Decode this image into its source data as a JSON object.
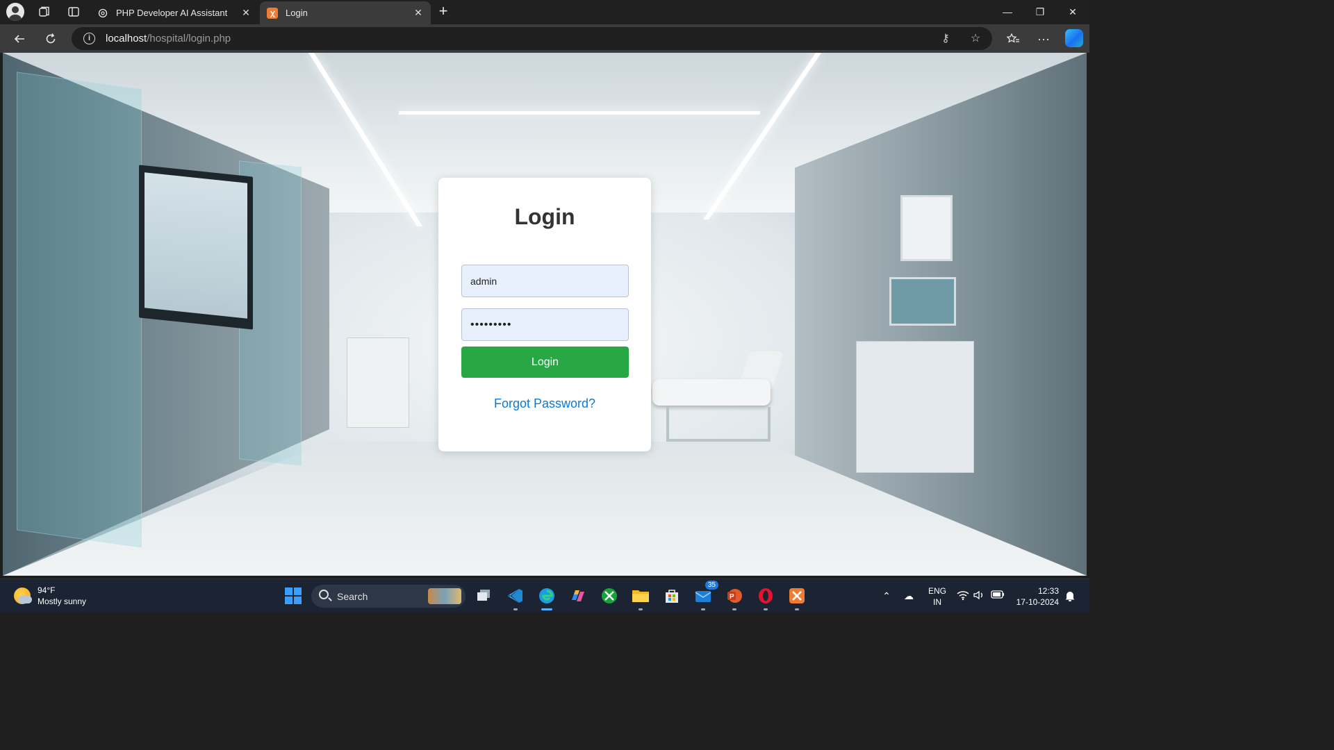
{
  "browser": {
    "tabs": [
      {
        "title": "PHP Developer AI Assistant",
        "icon": "openai-icon",
        "active": false
      },
      {
        "title": "Login",
        "icon": "xampp-icon",
        "active": true
      }
    ],
    "url_host": "localhost",
    "url_path": "/hospital/login.php"
  },
  "login": {
    "heading": "Login",
    "username_value": "admin",
    "password_value": "•••••••••",
    "button_label": "Login",
    "forgot_label": "Forgot Password?"
  },
  "taskbar": {
    "weather_temp": "94°F",
    "weather_desc": "Mostly sunny",
    "search_label": "Search",
    "mail_badge": "35",
    "lang_line1": "ENG",
    "lang_line2": "IN",
    "time": "12:33",
    "date": "17-10-2024"
  },
  "colors": {
    "login_button": "#28a745",
    "forgot_link": "#0a7ad8",
    "input_bg": "#e8f0fe"
  }
}
